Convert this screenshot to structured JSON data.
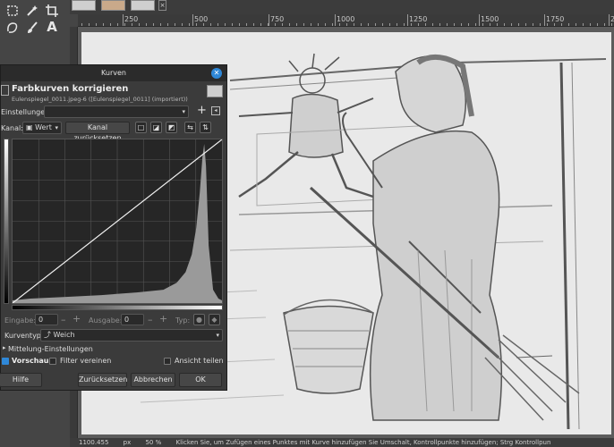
{
  "ruler": {
    "labels": [
      "250",
      "500",
      "750",
      "1000",
      "1250",
      "1500",
      "1750",
      "20"
    ]
  },
  "toolbox": {
    "icons": [
      "rect-select-icon",
      "fuzzy-select-icon",
      "crop-icon",
      "free-select-icon",
      "paintbrush-icon",
      "text-icon"
    ],
    "text_tool_glyph": "A"
  },
  "dialog": {
    "title": "Kurven",
    "header": "Farbkurven korrigieren",
    "subheader": "Eulenspiegel_0011.jpeg-6 ([Eulenspiegel_0011] (importiert))",
    "einstellungen_label": "Einstellungen:",
    "kanal_label": "Kanal:",
    "kanal_value": "Wert",
    "kanal_reset": "Kanal zurücksetzen",
    "eingabe_label": "Eingabe:",
    "eingabe_value": "0",
    "ausgabe_label": "Ausgabe:",
    "ausgabe_value": "0",
    "typ_label": "Typ:",
    "kurventyp_label": "Kurventyp:",
    "kurventyp_value": "Weich",
    "mittelung": "Mittelung-Einstellungen",
    "vorschau": "Vorschau",
    "vorschau_checked": true,
    "filter_vereinen": "Filter vereinen",
    "filter_checked": false,
    "ansicht_teilen": "Ansicht teilen",
    "ansicht_checked": false,
    "buttons": {
      "hilfe": "Hilfe",
      "reset": "Zurücksetzen",
      "cancel": "Abbrechen",
      "ok": "OK"
    }
  },
  "statusbar": {
    "zoom": "1100.455",
    "unit": "px",
    "percent": "50 %",
    "hint": "Klicken Sie, um Zufügen eines Punktes mit Kurve hinzufügen Sie Umschalt, Kontrollpunkte hinzufügen; Strg Kontrollpun"
  },
  "colors": {
    "accent": "#2f88d8",
    "dialog_bg": "#3b3b3b",
    "curve_bg": "#262626"
  }
}
